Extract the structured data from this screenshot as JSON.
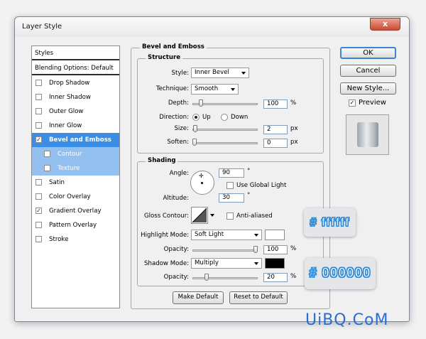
{
  "window": {
    "title": "Layer Style",
    "close": "x"
  },
  "styles_panel": {
    "header": "Styles",
    "blending": "Blending Options: Default",
    "items": [
      {
        "label": "Drop Shadow",
        "checked": false
      },
      {
        "label": "Inner Shadow",
        "checked": false
      },
      {
        "label": "Outer Glow",
        "checked": false
      },
      {
        "label": "Inner Glow",
        "checked": false
      },
      {
        "label": "Bevel and Emboss",
        "checked": true
      },
      {
        "label": "Contour",
        "checked": false
      },
      {
        "label": "Texture",
        "checked": false
      },
      {
        "label": "Satin",
        "checked": false
      },
      {
        "label": "Color Overlay",
        "checked": false
      },
      {
        "label": "Gradient Overlay",
        "checked": true
      },
      {
        "label": "Pattern Overlay",
        "checked": false
      },
      {
        "label": "Stroke",
        "checked": false
      }
    ],
    "check_mark": "✓"
  },
  "bevel": {
    "section_title": "Bevel and Emboss",
    "structure_title": "Structure",
    "style_label": "Style:",
    "style_value": "Inner Bevel",
    "technique_label": "Technique:",
    "technique_value": "Smooth",
    "depth_label": "Depth:",
    "depth_value": "100",
    "depth_unit": "%",
    "direction_label": "Direction:",
    "direction_up": "Up",
    "direction_down": "Down",
    "size_label": "Size:",
    "size_value": "2",
    "size_unit": "px",
    "soften_label": "Soften:",
    "soften_value": "0",
    "soften_unit": "px"
  },
  "shading": {
    "title": "Shading",
    "angle_label": "Angle:",
    "angle_value": "90",
    "angle_unit": "°",
    "global_light_label": "Use Global Light",
    "global_light_checked": false,
    "altitude_label": "Altitude:",
    "altitude_value": "30",
    "altitude_unit": "°",
    "gloss_label": "Gloss Contour:",
    "anti_aliased_label": "Anti-aliased",
    "highlight_mode_label": "Highlight Mode:",
    "highlight_mode_value": "Soft Light",
    "highlight_color": "#ffffff",
    "highlight_opacity_label": "Opacity:",
    "highlight_opacity_value": "100",
    "highlight_opacity_unit": "%",
    "shadow_mode_label": "Shadow Mode:",
    "shadow_mode_value": "Multiply",
    "shadow_color": "#000000",
    "shadow_opacity_label": "Opacity:",
    "shadow_opacity_value": "20",
    "shadow_opacity_unit": "%"
  },
  "bottom_buttons": {
    "make_default": "Make Default",
    "reset_default": "Reset to Default"
  },
  "side_buttons": {
    "ok": "OK",
    "cancel": "Cancel",
    "new_style": "New Style...",
    "preview_label": "Preview",
    "preview_checked": true
  },
  "annotations": {
    "white_hex": "# ffffff",
    "black_hex": "# 000000"
  },
  "watermark": "UiBQ.CoM",
  "colors": {
    "accent": "#3a8ee6",
    "badge_text": "#2b87d6"
  }
}
